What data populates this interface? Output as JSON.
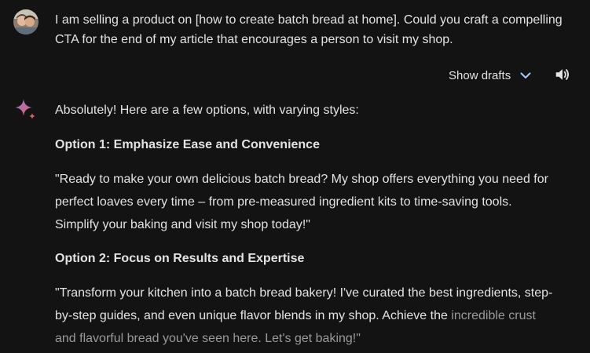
{
  "user": {
    "prompt": "I am selling a product on [how to create batch bread at home]. Could you craft a compelling CTA for the end of my article that encourages a person to visit my shop."
  },
  "drafts": {
    "label": "Show drafts",
    "icon": "chevron-down-icon"
  },
  "tts": {
    "icon": "speaker-icon"
  },
  "response": {
    "intro": "Absolutely! Here are a few options, with varying styles:",
    "options": [
      {
        "heading": "Option 1: Emphasize Ease and Convenience",
        "text": "\"Ready to make your own delicious batch bread? My shop offers everything you need for perfect loaves every time – from pre-measured ingredient kits to time-saving tools. Simplify your baking and visit my shop today!\""
      },
      {
        "heading": "Option 2: Focus on Results and Expertise",
        "text": "\"Transform your kitchen into a batch bread bakery! I've curated the best ingredients, step-by-step guides, and even unique flavor blends in my shop. Achieve the",
        "text_faded": "incredible crust and flavorful bread you've seen here. Let's get baking!\""
      }
    ]
  },
  "colors": {
    "background": "#131314",
    "text": "#e3e3e3",
    "faded_text": "#9a9a9b",
    "accent_blue": "#a8c7fa",
    "spark_start": "#9b72cb",
    "spark_end": "#d96570"
  }
}
